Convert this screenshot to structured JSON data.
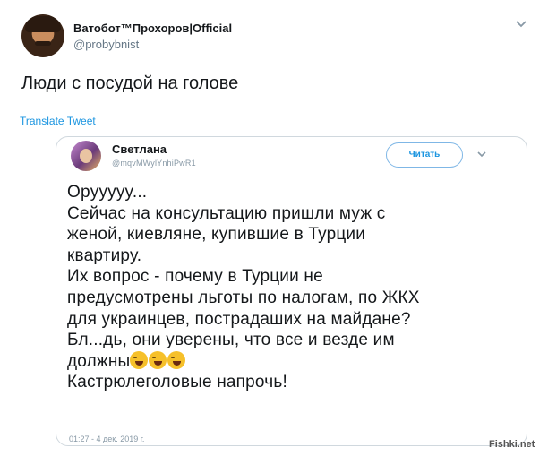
{
  "tweet": {
    "author_name": "Ватобот™Прохоров|Official",
    "author_handle": "@probybnist",
    "text": "Люди с посудой на голове",
    "translate_label": "Translate Tweet"
  },
  "embedded_tweet": {
    "author_name": "Светлана",
    "author_handle": "@mqvMWylYnhiPwR1",
    "follow_label": "Читать",
    "lines": [
      "Орyyyyy...",
      "Сейчас на консультацию пришли муж с",
      "женой, киевляне, купившие в Турции",
      "квартиру.",
      "Их вопрос - почему в Турции не",
      "предусмотрены льготы по налогам, по ЖКХ",
      "для украинцев, пострадаших на майдане?",
      "Бл...дь, они уверены, что все и везде им",
      "должны",
      "Кастрюлеголовые напрочь!"
    ],
    "emoji": [
      "rolling-on-floor-laughing",
      "rolling-on-floor-laughing",
      "rolling-on-floor-laughing"
    ],
    "timestamp": "01:27 - 4 дек. 2019 г."
  },
  "watermark": "Fishki.net",
  "colors": {
    "link": "#1b95e0",
    "secondary": "#657786",
    "border": "#d0d8de"
  }
}
